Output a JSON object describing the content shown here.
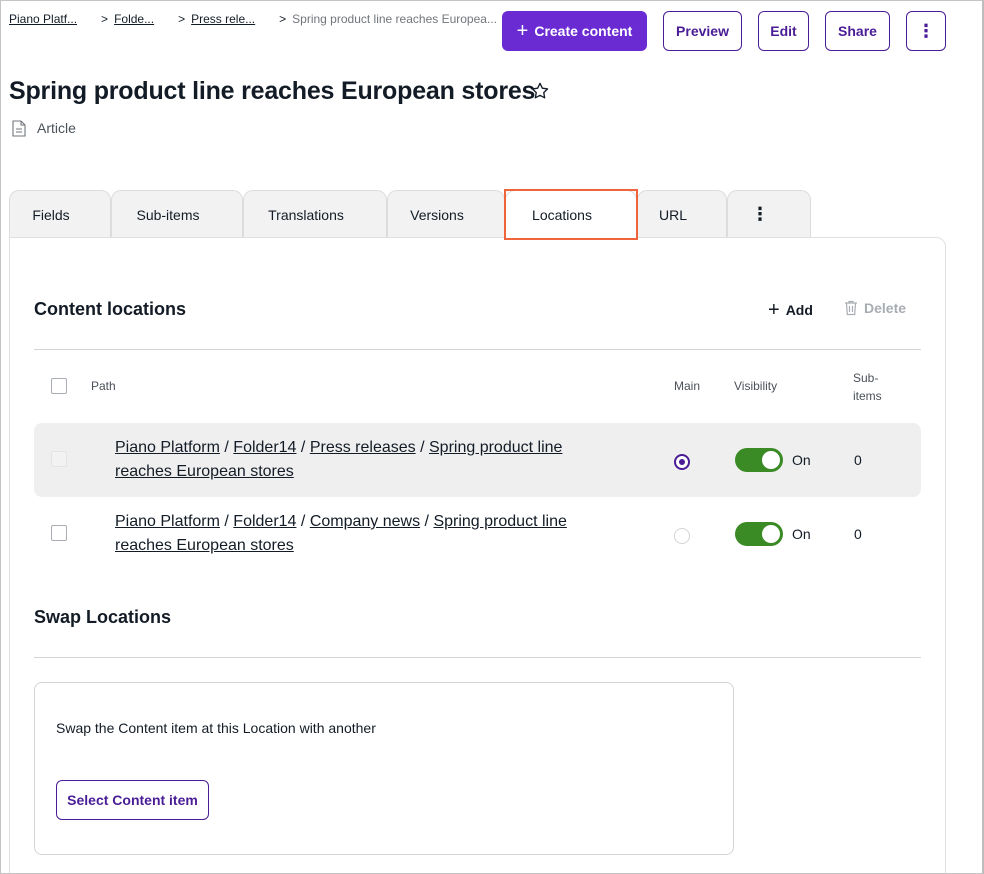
{
  "breadcrumb": {
    "items": [
      "Piano Platf...",
      "Folde...",
      "Press rele..."
    ],
    "separator": ">",
    "current": "Spring product line reaches Europea..."
  },
  "header": {
    "create_label": "Create content",
    "preview_label": "Preview",
    "edit_label": "Edit",
    "share_label": "Share",
    "more_label": "⋮"
  },
  "page": {
    "title": "Spring product line reaches European stores",
    "content_type": "Article"
  },
  "tabs": [
    {
      "label": "Fields"
    },
    {
      "label": "Sub-items"
    },
    {
      "label": "Translations"
    },
    {
      "label": "Versions"
    },
    {
      "label": "Locations",
      "active": true
    },
    {
      "label": "URL"
    },
    {
      "label": "⋮"
    }
  ],
  "locations": {
    "title": "Content locations",
    "add_label": "Add",
    "delete_label": "Delete",
    "columns": {
      "path": "Path",
      "main": "Main",
      "visibility": "Visibility",
      "subitems_line1": "Sub-",
      "subitems_line2": "items"
    },
    "rows": [
      {
        "p1": "Piano Platform",
        "p2": "Folder14",
        "p3": "Press releases",
        "p4": "Spring product line",
        "p5": "reaches European stores",
        "sep": "/",
        "main": true,
        "visibility": "On",
        "subitems": "0"
      },
      {
        "p1": "Piano Platform",
        "p2": "Folder14",
        "p3": "Company news",
        "p4": "Spring product line",
        "p5": "reaches European stores",
        "sep": "/",
        "main": false,
        "visibility": "On",
        "subitems": "0"
      }
    ]
  },
  "swap": {
    "title": "Swap Locations",
    "description": "Swap the Content item at this Location with another",
    "button_label": "Select Content item"
  },
  "colors": {
    "primary": "#6b2bd3",
    "primary_dark": "#4a1d96",
    "toggle_on": "#3a8a25",
    "highlight": "#f0643c"
  }
}
